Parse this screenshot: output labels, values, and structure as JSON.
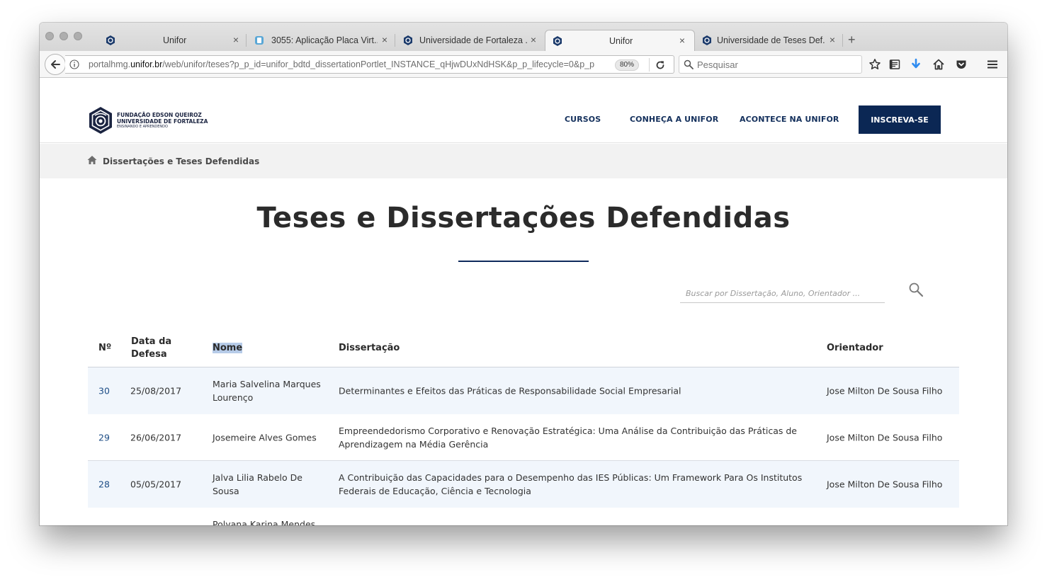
{
  "browser": {
    "tabs": [
      {
        "title": "Unifor",
        "active": false
      },
      {
        "title": "3055: Aplicação Placa Virt...",
        "active": false
      },
      {
        "title": "Universidade de Fortaleza ...",
        "active": false
      },
      {
        "title": "Unifor",
        "active": true
      },
      {
        "title": "Universidade de Teses Def...",
        "active": false
      }
    ],
    "url_host_prefix": "portalhmg.",
    "url_host_domain": "unifor.br",
    "url_path": "/web/unifor/teses?p_p_id=unifor_bdtd_dissertationPortlet_INSTANCE_qHjwDUxNdHSK&p_p_lifecycle=0&p_p",
    "zoom": "80%",
    "search_placeholder": "Pesquisar"
  },
  "site": {
    "logo": {
      "line1": "FUNDAÇÃO EDSON QUEIROZ",
      "line2": "UNIVERSIDADE DE FORTALEZA",
      "line3": "ENSINANDO E APRENDENDO"
    },
    "nav": {
      "cursos": "CURSOS",
      "conheca": "CONHEÇA A UNIFOR",
      "acontece": "ACONTECE NA UNIFOR",
      "cta": "INSCREVA-SE"
    },
    "colors": {
      "primary": "#0b2754",
      "link": "#1d4d86",
      "row_shade": "#f1f6fc"
    }
  },
  "breadcrumb": {
    "current": "Dissertações e Teses Defendidas"
  },
  "main": {
    "title": "Teses e Dissertações Defendidas",
    "search_placeholder": "Buscar por Dissertação, Aluno, Orientador ..."
  },
  "table": {
    "headers": {
      "num": "Nº",
      "date_l1": "Data da",
      "date_l2": "Defesa",
      "name": "Nome",
      "dissertation": "Dissertação",
      "advisor": "Orientador"
    },
    "rows": [
      {
        "num": "30",
        "date": "25/08/2017",
        "name_l1": "Maria Salvelina Marques",
        "name_l2": "Lourenço",
        "diss_l1": "Determinantes e Efeitos das Práticas de Responsabilidade Social Empresarial",
        "diss_l2": "",
        "advisor": "Jose Milton De Sousa Filho"
      },
      {
        "num": "29",
        "date": "26/06/2017",
        "name_l1": "Josemeire Alves Gomes",
        "name_l2": "",
        "diss_l1": "Empreendedorismo Corporativo e Renovação Estratégica: Uma Análise da Contribuição das Práticas de",
        "diss_l2": "Aprendizagem na Média Gerência",
        "advisor": "Jose Milton De Sousa Filho"
      },
      {
        "num": "28",
        "date": "05/05/2017",
        "name_l1": "Jalva Lilia Rabelo De",
        "name_l2": "Sousa",
        "diss_l1": "A Contribuição das Capacidades para o Desempenho das IES Públicas: Um Framework Para Os Institutos",
        "diss_l2": "Federais de Educação, Ciência e Tecnologia",
        "advisor": "Jose Milton De Sousa Filho"
      },
      {
        "num": "",
        "date": "",
        "name_l1": "Polyana Karina Mendes",
        "name_l2": "",
        "diss_l1": "",
        "diss_l2": "",
        "advisor": ""
      }
    ]
  }
}
